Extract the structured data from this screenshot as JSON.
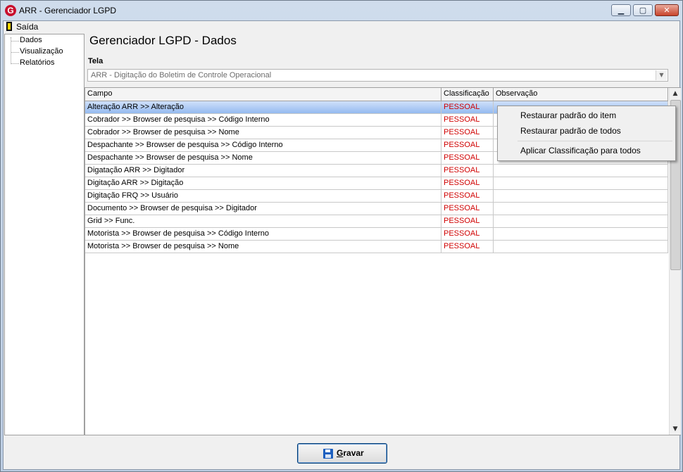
{
  "window": {
    "title": "ARR - Gerenciador LGPD",
    "logo_letter": "G",
    "buttons": {
      "minimize": "▁",
      "maximize": "▢",
      "close": "✕"
    }
  },
  "menu": {
    "exit_label": "Saída"
  },
  "sidebar": {
    "items": [
      {
        "label": "Dados"
      },
      {
        "label": "Visualização"
      },
      {
        "label": "Relatórios"
      }
    ]
  },
  "main": {
    "title": "Gerenciador LGPD - Dados",
    "tela_label": "Tela",
    "tela_value": "ARR - Digitação do Boletim de Controle Operacional"
  },
  "grid": {
    "columns": [
      "Campo",
      "Classificação",
      "Observação"
    ],
    "rows": [
      {
        "campo": "Alteração ARR >> Alteração",
        "classificacao": "PESSOAL",
        "observacao": ""
      },
      {
        "campo": "Cobrador >> Browser de pesquisa >> Código Interno",
        "classificacao": "PESSOAL",
        "observacao": ""
      },
      {
        "campo": "Cobrador >> Browser de pesquisa >> Nome",
        "classificacao": "PESSOAL",
        "observacao": ""
      },
      {
        "campo": "Despachante >> Browser de pesquisa >> Código Interno",
        "classificacao": "PESSOAL",
        "observacao": ""
      },
      {
        "campo": "Despachante >> Browser de pesquisa >> Nome",
        "classificacao": "PESSOAL",
        "observacao": ""
      },
      {
        "campo": "Digatação ARR >> Digitador",
        "classificacao": "PESSOAL",
        "observacao": ""
      },
      {
        "campo": "Digitação ARR >> Digitação",
        "classificacao": "PESSOAL",
        "observacao": ""
      },
      {
        "campo": "Digitação FRQ >> Usuário",
        "classificacao": "PESSOAL",
        "observacao": ""
      },
      {
        "campo": "Documento >> Browser de pesquisa >> Digitador",
        "classificacao": "PESSOAL",
        "observacao": ""
      },
      {
        "campo": "Grid >> Func.",
        "classificacao": "PESSOAL",
        "observacao": ""
      },
      {
        "campo": "Motorista >> Browser de pesquisa >> Código Interno",
        "classificacao": "PESSOAL",
        "observacao": ""
      },
      {
        "campo": "Motorista >> Browser de pesquisa >> Nome",
        "classificacao": "PESSOAL",
        "observacao": ""
      }
    ],
    "selected_row": 0
  },
  "context_menu": {
    "items": [
      "Restaurar padrão do item",
      "Restaurar padrão de todos",
      "Aplicar Classificação para todos"
    ]
  },
  "footer": {
    "save_label_first": "G",
    "save_label_rest": "ravar"
  },
  "colors": {
    "classification_text": "#d00000",
    "selection": "#91b8ef",
    "close_button": "#c8442c"
  }
}
